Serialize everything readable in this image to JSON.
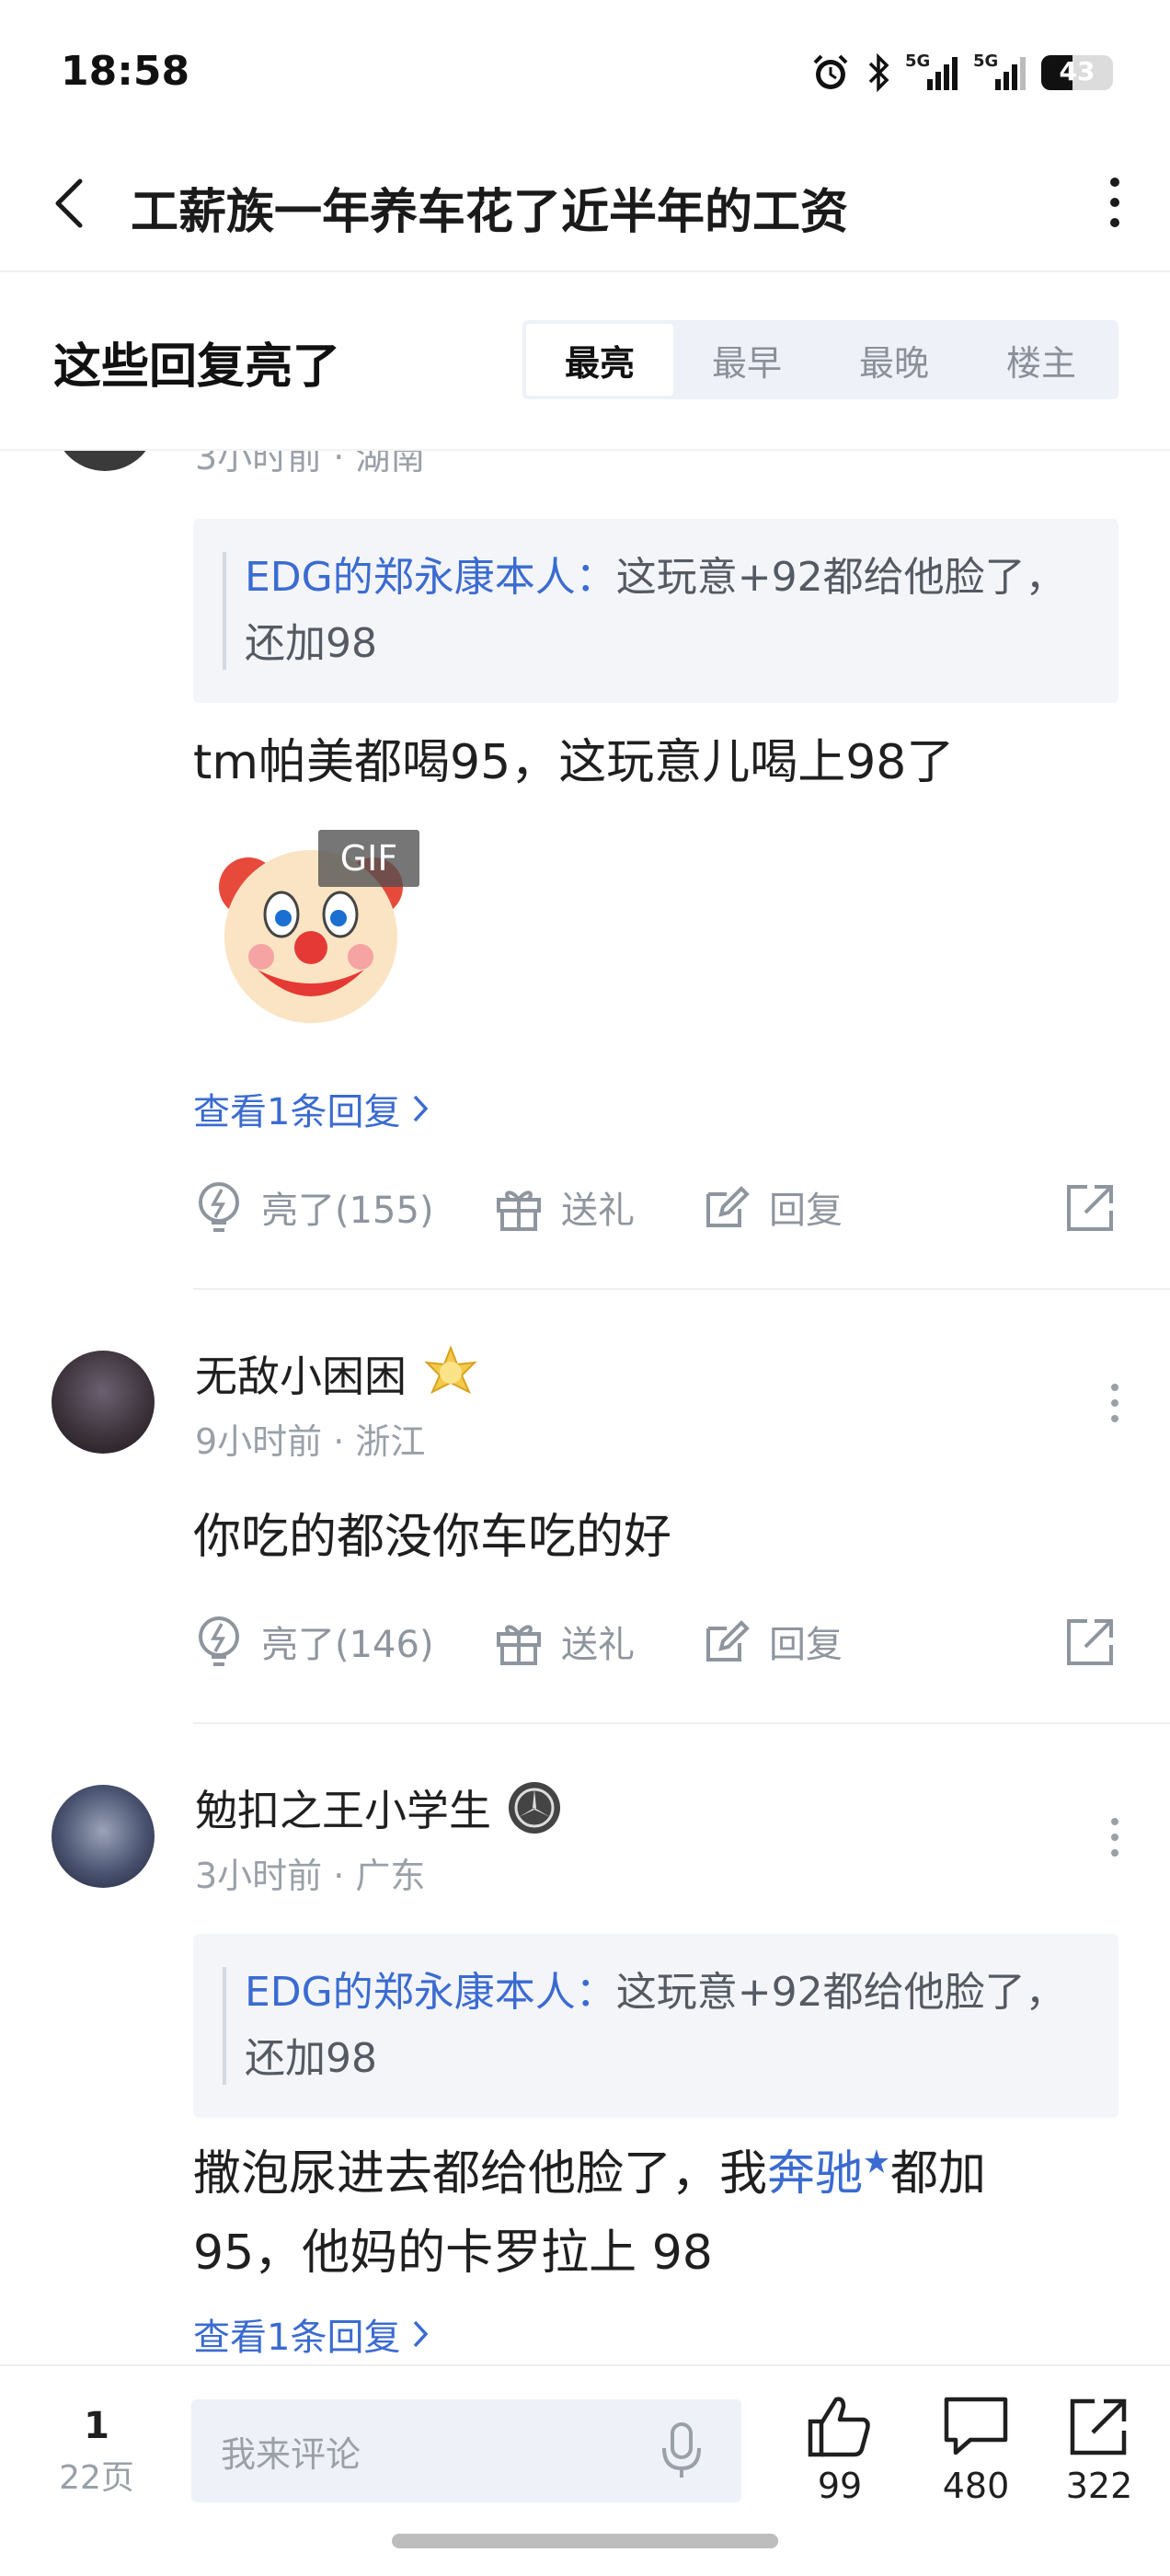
{
  "status": {
    "time": "18:58",
    "battery": "43",
    "battery_level": 0.43,
    "net1": "5G",
    "net2": "5G"
  },
  "nav": {
    "title": "工薪族一年养车花了近半年的工资"
  },
  "section": {
    "title": "这些回复亮了",
    "tabs": [
      "最亮",
      "最早",
      "最晚",
      "楼主"
    ]
  },
  "comments": [
    {
      "meta": "3小时前 · 湖南",
      "quote_author": "EDG的郑永康本人：",
      "quote_text": "这玩意+92都给他脸了，还加98",
      "body": "tm帕美都喝95，这玩意儿喝上98了",
      "gif_label": "GIF",
      "view_replies": "查看1条回复",
      "like_label": "亮了(155)",
      "gift_label": "送礼",
      "reply_label": "回复"
    },
    {
      "username": "无敌小困困",
      "meta": "9小时前 · 浙江",
      "body": "你吃的都没你车吃的好",
      "like_label": "亮了(146)",
      "gift_label": "送礼",
      "reply_label": "回复"
    },
    {
      "username": "勉扣之王小学生",
      "meta": "3小时前 · 广东",
      "quote_author": "EDG的郑永康本人：",
      "quote_text": "这玩意+92都给他脸了，还加98",
      "body_part1": "撒泡尿进去都给他脸了，我",
      "body_link": "奔驰",
      "body_part2": "都加",
      "body_line2": "95，他妈的卡罗拉上 98",
      "view_replies": "查看1条回复"
    }
  ],
  "bottom": {
    "page_current": "1",
    "page_total": "22页",
    "input_placeholder": "我来评论",
    "like_count": "99",
    "comment_count": "480",
    "share_count": "322"
  },
  "colors": {
    "link": "#3b6bd1",
    "muted": "#9aa0a8",
    "tab_bg": "#eef1f7"
  }
}
